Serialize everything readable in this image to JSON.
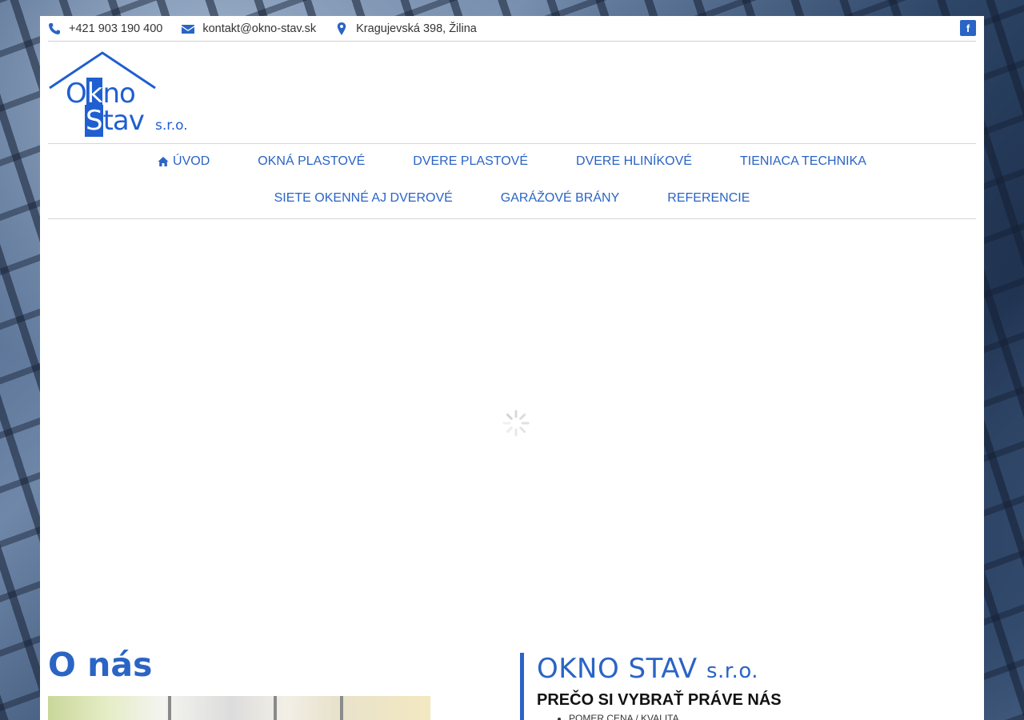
{
  "topbar": {
    "phone": "+421 903 190 400",
    "email": "kontakt@okno-stav.sk",
    "address": "Kragujevská 398, Žilina",
    "social": "f"
  },
  "logo": {
    "word1": [
      "O",
      "k",
      "no"
    ],
    "word2": [
      "S",
      "tav"
    ],
    "suffix": "s.r.o."
  },
  "nav": {
    "row1": [
      "ÚVOD",
      "OKNÁ PLASTOVÉ",
      "DVERE PLASTOVÉ",
      "DVERE HLINÍKOVÉ",
      "TIENIACA TECHNIKA"
    ],
    "row2": [
      "SIETE OKENNÉ AJ DVEROVÉ",
      "GARÁŽOVÉ BRÁNY",
      "REFERENCIE"
    ]
  },
  "about": {
    "title": "O nás",
    "brand": "OKNO STAV",
    "brand_suffix": "s.r.o.",
    "why_title": "PREČO SI VYBRAŤ PRÁVE NÁS",
    "why_items": [
      "POMER CENA / KVALITA"
    ]
  },
  "colors": {
    "accent": "#2a64c5",
    "text": "#333333"
  },
  "icons": {
    "phone": "phone-icon",
    "email": "envelope-icon",
    "address": "map-marker-icon",
    "home": "home-icon",
    "facebook": "facebook-icon"
  }
}
